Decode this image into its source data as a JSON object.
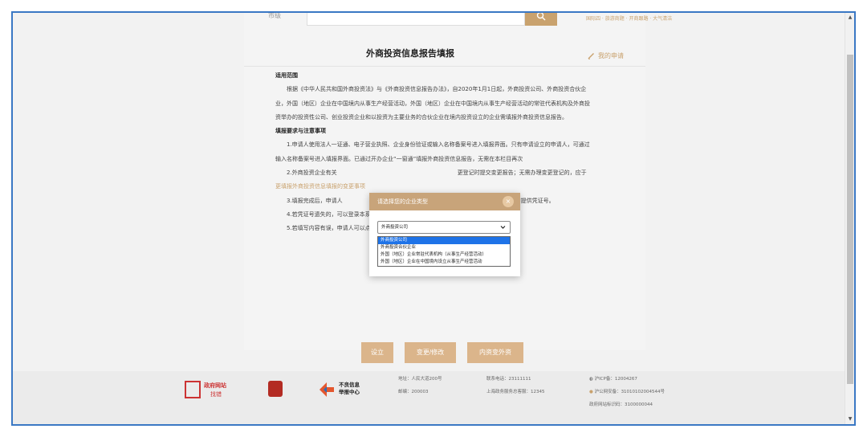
{
  "header": {
    "city_label": "市级",
    "hot_links": "国际四 · 旅游商题 · 开商跟路 · 大气清洁",
    "page_title": "外商投资信息报告填报",
    "my_apply": "我的申请"
  },
  "content": {
    "scope_heading": "适用范围",
    "scope_text": "根据《中华人民共和国外商投资法》与《外商投资信息报告办法》，自2020年1月1日起，外商投资公司、外商投资合伙企业，外国（地区）企业在中国境内从事生产经营活动，外国（地区）企业在中国境内从事生产经营活动的常驻代表机构及外商投资举办的投资性公司、创业投资企业和以投资为主要业务的合伙企业在境内投资设立的企业需填报外商投资信息报告。",
    "req_heading": "填报要求与注意事项",
    "req1": "1.申请人使用法人一证通、电子营业执照、企业身份验证或输入名称备案号进入填报界面。只有申请设立的申请人，可通过输入名称备案号进入填报界面。已通过开办企业“一窗通”填报外商投资信息报告，无需在本栏目再次",
    "req2_a": "2.外商投资企业有关",
    "req2_b": "更登记时提交变更报告；无需办理变更登记的，应于",
    "req2_link": "更填报外商投资信息填报的变更事项",
    "req3_a": "3.填报完成后，申请人",
    "req3_b": "项的，则无需提供凭证号。",
    "req4": "4.若凭证号遗失的，可以登录本系统“我的申请”入口查询申请案。",
    "req5": "5.若填写内容有误，申请人可以点击修改按钮再次填报，填报完成后系统会生成新的凭证号。"
  },
  "buttons": {
    "establish": "设立",
    "change": "变更/修改",
    "domestic_to_foreign": "内资变外资"
  },
  "footer": {
    "gov_site": "政府网站",
    "gov_error": "找错",
    "report_line1": "不良信息",
    "report_line2": "举报中心",
    "address": "地址：人民大道200号",
    "postcode": "邮编：200003",
    "phone": "联系电话：23111111",
    "service": "上海政务服务总客服：12345",
    "icp": "沪ICP备：12004267",
    "police": "沪公网安备：31010102004544号",
    "site_code": "政府网站标识码：3100000044"
  },
  "modal": {
    "title": "请选择您的企业类型",
    "close": "×",
    "selected": "外商投资公司",
    "options": [
      "外商投资公司",
      "外商投资合伙企业",
      "外国（地区）企业常驻代表机构（从事生产经营活动）",
      "外国（地区）企业在中国境内设立从事生产经营活动"
    ]
  },
  "colors": {
    "accent": "#c9a26e",
    "button": "#dbb58b",
    "modal_header": "#c8a47a",
    "selection": "#1e73e8",
    "frame_border": "#3a78c4"
  }
}
